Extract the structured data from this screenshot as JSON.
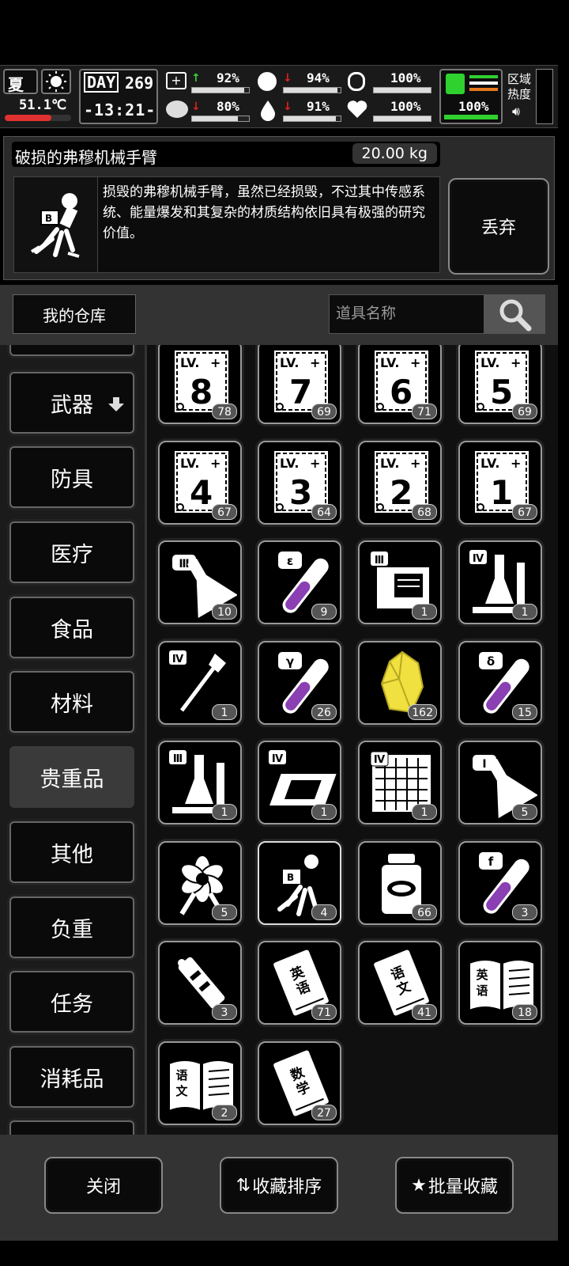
{
  "status": {
    "season": "夏",
    "temperature": "51.1℃",
    "day_label": "DAY",
    "day": "269",
    "time": "-13:21-",
    "stats": [
      {
        "name": "health",
        "value": "92%",
        "trend": "up"
      },
      {
        "name": "stomach",
        "value": "94%",
        "trend": "down"
      },
      {
        "name": "stamina",
        "value": "100%",
        "trend": ""
      },
      {
        "name": "mood",
        "value": "80%",
        "trend": "down"
      },
      {
        "name": "water",
        "value": "91%",
        "trend": "down"
      },
      {
        "name": "heart",
        "value": "100%",
        "trend": ""
      }
    ],
    "load_value": "100%",
    "zone_heat_label": "区域热度"
  },
  "detail": {
    "item_name": "破损的弗穆机械手臂",
    "weight": "20.00 kg",
    "description": "损毁的弗穆机械手臂，虽然已经损毁，不过其中传感系统、能量爆发和其复杂的材质结构依旧具有极强的研究价值。",
    "discard_label": "丢弃"
  },
  "warehouse": {
    "title": "我的仓库",
    "search_placeholder": "道具名称"
  },
  "categories": [
    {
      "label": "武器"
    },
    {
      "label": "防具"
    },
    {
      "label": "医疗"
    },
    {
      "label": "食品"
    },
    {
      "label": "材料"
    },
    {
      "label": "贵重品"
    },
    {
      "label": "其他"
    },
    {
      "label": "负重"
    },
    {
      "label": "任务"
    },
    {
      "label": "消耗品"
    }
  ],
  "active_category": "贵重品",
  "items": [
    {
      "icon": "blueprint-lv8-icon",
      "text": "8",
      "count": "78"
    },
    {
      "icon": "blueprint-lv7-icon",
      "text": "7",
      "count": "69"
    },
    {
      "icon": "blueprint-lv6-icon",
      "text": "6",
      "count": "71"
    },
    {
      "icon": "blueprint-lv5-icon",
      "text": "5",
      "count": "69"
    },
    {
      "icon": "blueprint-lv4-icon",
      "text": "4",
      "count": "67"
    },
    {
      "icon": "blueprint-lv3-icon",
      "text": "3",
      "count": "64"
    },
    {
      "icon": "blueprint-lv2-icon",
      "text": "2",
      "count": "68"
    },
    {
      "icon": "blueprint-lv1-icon",
      "text": "1",
      "count": "67"
    },
    {
      "icon": "flask-iii-icon",
      "text": "Ⅲ",
      "count": "10"
    },
    {
      "icon": "test-tube-epsilon-icon",
      "text": "ε",
      "count": "9"
    },
    {
      "icon": "machine-iii-icon",
      "text": "Ⅲ",
      "count": "1"
    },
    {
      "icon": "lab-equipment-iv-icon",
      "text": "Ⅳ",
      "count": "1"
    },
    {
      "icon": "tool-iv-icon",
      "text": "Ⅳ",
      "count": "1"
    },
    {
      "icon": "test-tube-gamma-icon",
      "text": "γ",
      "count": "26"
    },
    {
      "icon": "yellow-crystal-icon",
      "text": "",
      "count": "162"
    },
    {
      "icon": "test-tube-delta-icon",
      "text": "δ",
      "count": "15"
    },
    {
      "icon": "lab-equipment-iii-icon",
      "text": "Ⅲ",
      "count": "1"
    },
    {
      "icon": "chip-iv-icon",
      "text": "Ⅳ",
      "count": "1"
    },
    {
      "icon": "circuit-board-iv-icon",
      "text": "Ⅳ",
      "count": "1"
    },
    {
      "icon": "flask-i-icon",
      "text": "Ⅰ",
      "count": "5"
    },
    {
      "icon": "flower-icon",
      "text": "",
      "count": "5"
    },
    {
      "icon": "mechanical-arm-icon",
      "text": "",
      "count": "4"
    },
    {
      "icon": "jar-icon",
      "text": "",
      "count": "66"
    },
    {
      "icon": "test-tube-f-icon",
      "text": "f",
      "count": "3"
    },
    {
      "icon": "broken-device-icon",
      "text": "",
      "count": "3"
    },
    {
      "icon": "english-book-icon",
      "text": "英语",
      "count": "71"
    },
    {
      "icon": "chinese-book-icon",
      "text": "语文",
      "count": "41"
    },
    {
      "icon": "english-open-book-icon",
      "text": "英语",
      "count": "18"
    },
    {
      "icon": "chinese-open-book-icon",
      "text": "语文",
      "count": "2"
    },
    {
      "icon": "math-book-icon",
      "text": "数学",
      "count": "27"
    }
  ],
  "bottom": {
    "close_label": "关闭",
    "sort_label": "收藏排序",
    "batch_label": "批量收藏"
  }
}
